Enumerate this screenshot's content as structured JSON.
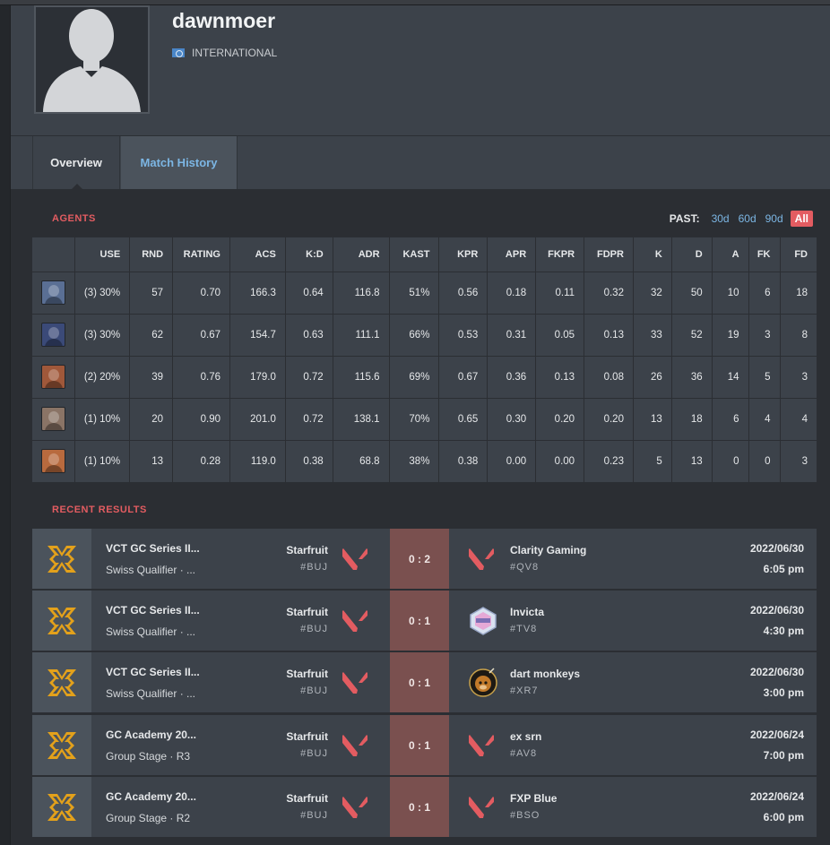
{
  "player": {
    "name": "dawnmoer",
    "country": "INTERNATIONAL"
  },
  "tabs": [
    {
      "label": "Overview",
      "active": true
    },
    {
      "label": "Match History",
      "active": false
    }
  ],
  "agents_section": {
    "title": "AGENTS",
    "past_label": "PAST:",
    "filters": [
      "30d",
      "60d",
      "90d",
      "All"
    ],
    "active_filter": "All",
    "columns": [
      "",
      "USE",
      "RND",
      "RATING",
      "ACS",
      "K:D",
      "ADR",
      "KAST",
      "KPR",
      "APR",
      "FKPR",
      "FDPR",
      "K",
      "D",
      "A",
      "FK",
      "FD"
    ],
    "rows": [
      {
        "agent_icon": "agent-portrait-1-icon",
        "color": "#5a6f94",
        "cells": [
          "(3) 30%",
          "57",
          "0.70",
          "166.3",
          "0.64",
          "116.8",
          "51%",
          "0.56",
          "0.18",
          "0.11",
          "0.32",
          "32",
          "50",
          "10",
          "6",
          "18"
        ]
      },
      {
        "agent_icon": "agent-portrait-2-icon",
        "color": "#3b4a78",
        "cells": [
          "(3) 30%",
          "62",
          "0.67",
          "154.7",
          "0.63",
          "111.1",
          "66%",
          "0.53",
          "0.31",
          "0.05",
          "0.13",
          "33",
          "52",
          "19",
          "3",
          "8"
        ]
      },
      {
        "agent_icon": "agent-portrait-3-icon",
        "color": "#a0583a",
        "cells": [
          "(2) 20%",
          "39",
          "0.76",
          "179.0",
          "0.72",
          "115.6",
          "69%",
          "0.67",
          "0.36",
          "0.13",
          "0.08",
          "26",
          "36",
          "14",
          "5",
          "3"
        ]
      },
      {
        "agent_icon": "agent-portrait-4-icon",
        "color": "#8a7466",
        "cells": [
          "(1) 10%",
          "20",
          "0.90",
          "201.0",
          "0.72",
          "138.1",
          "70%",
          "0.65",
          "0.30",
          "0.20",
          "0.20",
          "13",
          "18",
          "6",
          "4",
          "4"
        ]
      },
      {
        "agent_icon": "agent-portrait-5-icon",
        "color": "#b86a3e",
        "cells": [
          "(1) 10%",
          "13",
          "0.28",
          "119.0",
          "0.38",
          "68.8",
          "38%",
          "0.38",
          "0.00",
          "0.00",
          "0.23",
          "5",
          "13",
          "0",
          "0",
          "3"
        ]
      }
    ]
  },
  "results_section": {
    "title": "RECENT RESULTS",
    "matches": [
      {
        "event": "VCT GC Series II...",
        "stage": "Swiss Qualifier · ...",
        "team1": "Starfruit",
        "tag1": "#BUJ",
        "score": "0 : 2",
        "team2": "Clarity Gaming",
        "tag2": "#QV8",
        "team2_logo": "valorant-logo-icon",
        "date": "2022/06/30",
        "time": "6:05 pm"
      },
      {
        "event": "VCT GC Series II...",
        "stage": "Swiss Qualifier · ...",
        "team1": "Starfruit",
        "tag1": "#BUJ",
        "score": "0 : 1",
        "team2": "Invicta",
        "tag2": "#TV8",
        "team2_logo": "invicta-logo-icon",
        "date": "2022/06/30",
        "time": "4:30 pm"
      },
      {
        "event": "VCT GC Series II...",
        "stage": "Swiss Qualifier · ...",
        "team1": "Starfruit",
        "tag1": "#BUJ",
        "score": "0 : 1",
        "team2": "dart monkeys",
        "tag2": "#XR7",
        "team2_logo": "dart-monkeys-logo-icon",
        "date": "2022/06/30",
        "time": "3:00 pm"
      },
      {
        "event": "GC Academy 20...",
        "stage": "Group Stage · R3",
        "team1": "Starfruit",
        "tag1": "#BUJ",
        "score": "0 : 1",
        "team2": "ex srn",
        "tag2": "#AV8",
        "team2_logo": "valorant-logo-icon",
        "date": "2022/06/24",
        "time": "7:00 pm"
      },
      {
        "event": "GC Academy 20...",
        "stage": "Group Stage · R2",
        "team1": "Starfruit",
        "tag1": "#BUJ",
        "score": "0 : 1",
        "team2": "FXP Blue",
        "tag2": "#BSO",
        "team2_logo": "valorant-logo-icon",
        "date": "2022/06/24",
        "time": "6:00 pm"
      }
    ]
  },
  "colors": {
    "accent_red": "#e35c61",
    "link_blue": "#7cb6e4",
    "loss_score_bg": "#7a504f",
    "event_logo_gold": "#e3a11b",
    "valorant_red": "#e35c61"
  }
}
